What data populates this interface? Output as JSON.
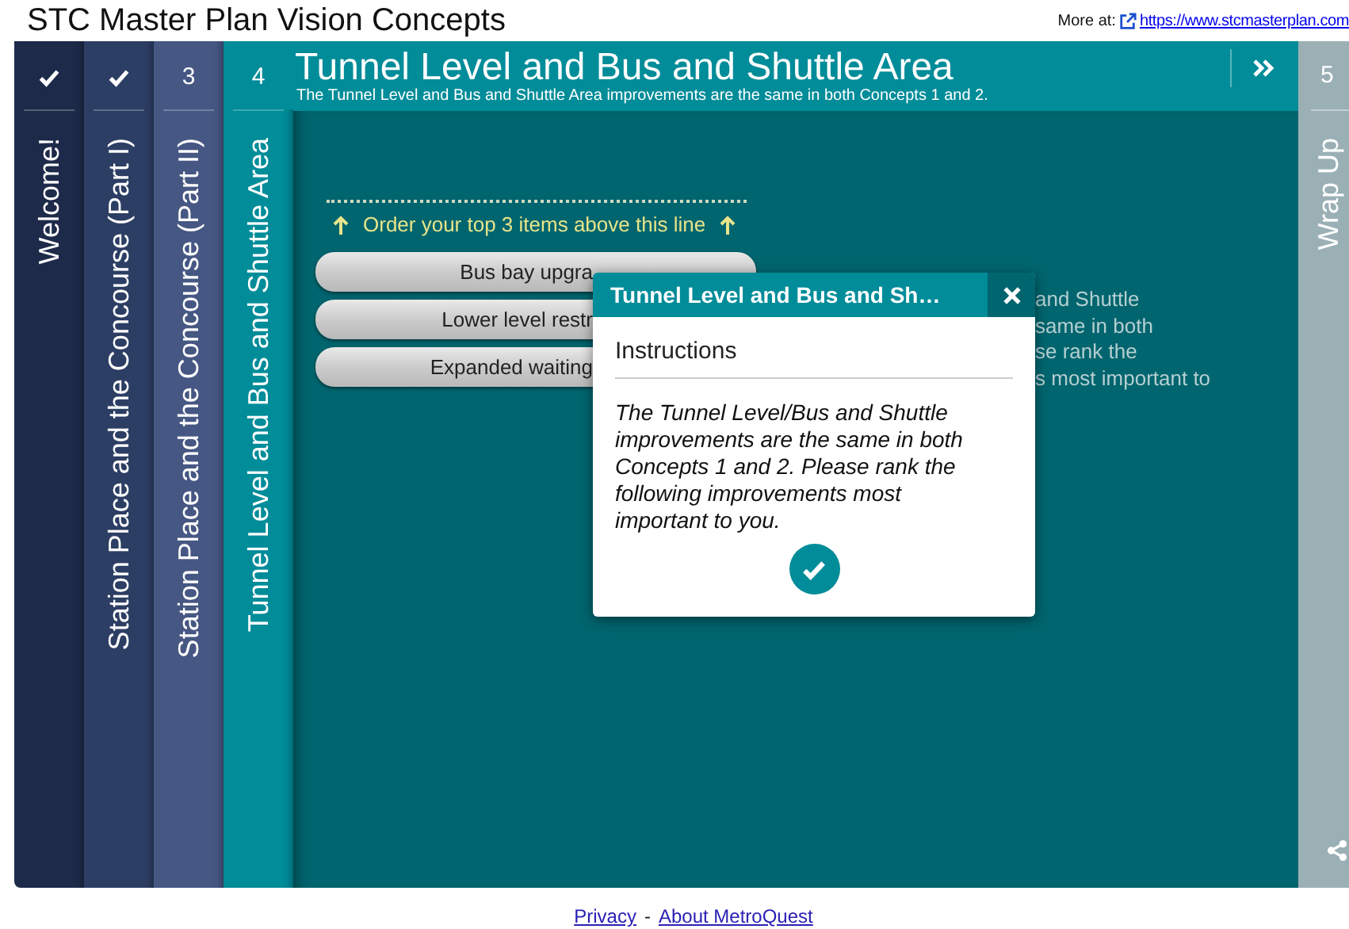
{
  "header": {
    "title": "STC Master Plan Vision Concepts",
    "more_label": "More at:",
    "link": "https://www.stcmasterplan.com"
  },
  "tabs": [
    {
      "label": "Welcome!",
      "completed": true,
      "selected": false
    },
    {
      "label": "Station Place and the Concourse (Part I)",
      "completed": true,
      "selected": false
    },
    {
      "label": "Station Place and the Concourse (Part II)",
      "completed": false,
      "number": "3",
      "selected": false
    },
    {
      "label": "Tunnel Level and Bus and Shuttle Area",
      "completed": false,
      "number": "4",
      "selected": true
    }
  ],
  "section": {
    "title": "Tunnel Level and Bus and Shuttle Area",
    "subtitle": "The Tunnel Level and Bus and Shuttle Area improvements are the same in both Concepts 1 and 2."
  },
  "ranking": {
    "hint": "Order your top 3 items above this line",
    "items": [
      "Bus bay upgra",
      "Lower level restr",
      "Expanded waiting"
    ],
    "background_text": "and Shuttle\nsame in both\nse rank the\ns most important to"
  },
  "dialog": {
    "title": "Tunnel Level and Bus and Sh…",
    "heading": "Instructions",
    "body": "The Tunnel Level/Bus and Shuttle improvements are the same in both Concepts 1 and 2. Please rank the following improvements most important to you."
  },
  "next_tab": {
    "number": "5",
    "label": "Wrap Up"
  },
  "footer": {
    "links": [
      "Privacy",
      "About MetroQuest"
    ],
    "separator": "-"
  }
}
